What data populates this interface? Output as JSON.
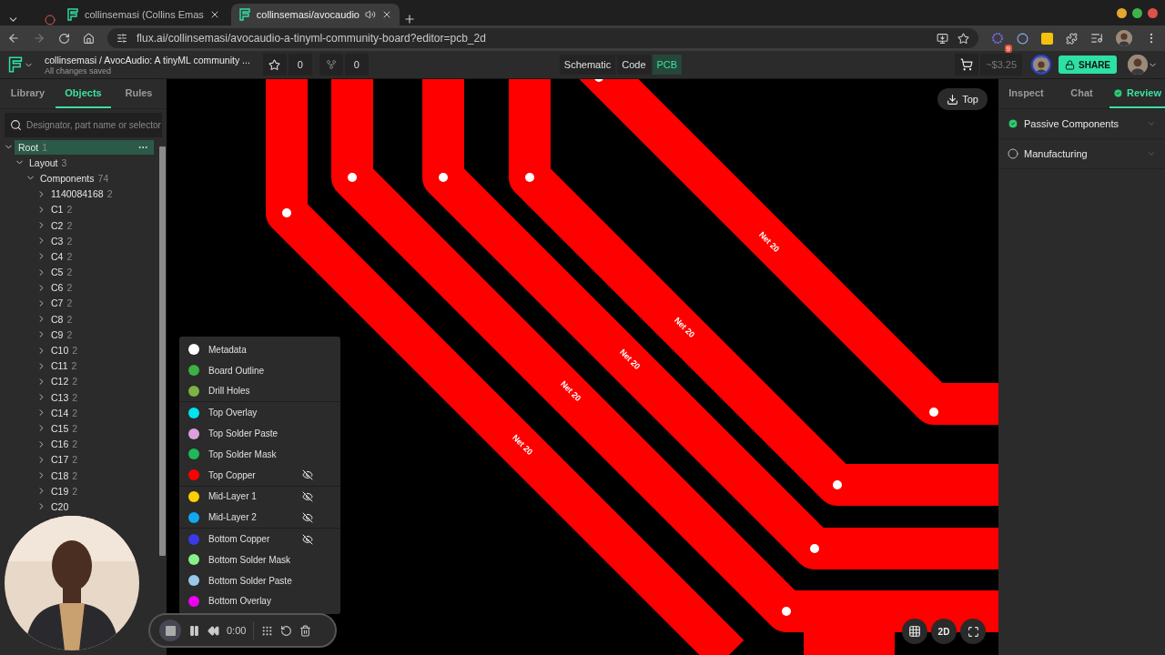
{
  "browser": {
    "tabs": [
      {
        "title": "collinsemasi (Collins Emas",
        "selected": false,
        "audio": false
      },
      {
        "title": "collinsemasi/avocaudio",
        "selected": true,
        "audio": true
      }
    ],
    "url": "flux.ai/collinsemasi/avocaudio-a-tinyml-community-board?editor=pcb_2d",
    "extension_badge": "9"
  },
  "header": {
    "project_title": "collinsemasi / AvocAudio: A tinyML community ...",
    "save_status": "All changes saved",
    "stars": "0",
    "forks": "0",
    "view_tabs": [
      {
        "label": "Schematic",
        "selected": false
      },
      {
        "label": "Code",
        "selected": false
      },
      {
        "label": "PCB",
        "selected": true
      }
    ],
    "price": "~$3.25",
    "share": "SHARE"
  },
  "left_panel": {
    "tabs": [
      {
        "label": "Library",
        "selected": false
      },
      {
        "label": "Objects",
        "selected": true
      },
      {
        "label": "Rules",
        "selected": false
      }
    ],
    "search": {
      "placeholder": "Designator, part name or selector"
    },
    "tree": [
      {
        "label": "Root",
        "count": "1",
        "expanded": true,
        "selected": true,
        "children": [
          {
            "label": "Layout",
            "count": "3",
            "expanded": true,
            "selected": false,
            "children": [
              {
                "label": "Components",
                "count": "74",
                "expanded": true,
                "selected": false,
                "children": [
                  {
                    "label": "1140084168",
                    "count": "2",
                    "expanded": false,
                    "selected": false
                  },
                  {
                    "label": "C1",
                    "count": "2",
                    "expanded": false,
                    "selected": false
                  },
                  {
                    "label": "C2",
                    "count": "2",
                    "expanded": false,
                    "selected": false
                  },
                  {
                    "label": "C3",
                    "count": "2",
                    "expanded": false,
                    "selected": false
                  },
                  {
                    "label": "C4",
                    "count": "2",
                    "expanded": false,
                    "selected": false
                  },
                  {
                    "label": "C5",
                    "count": "2",
                    "expanded": false,
                    "selected": false
                  },
                  {
                    "label": "C6",
                    "count": "2",
                    "expanded": false,
                    "selected": false
                  },
                  {
                    "label": "C7",
                    "count": "2",
                    "expanded": false,
                    "selected": false
                  },
                  {
                    "label": "C8",
                    "count": "2",
                    "expanded": false,
                    "selected": false
                  },
                  {
                    "label": "C9",
                    "count": "2",
                    "expanded": false,
                    "selected": false
                  },
                  {
                    "label": "C10",
                    "count": "2",
                    "expanded": false,
                    "selected": false
                  },
                  {
                    "label": "C11",
                    "count": "2",
                    "expanded": false,
                    "selected": false
                  },
                  {
                    "label": "C12",
                    "count": "2",
                    "expanded": false,
                    "selected": false
                  },
                  {
                    "label": "C13",
                    "count": "2",
                    "expanded": false,
                    "selected": false
                  },
                  {
                    "label": "C14",
                    "count": "2",
                    "expanded": false,
                    "selected": false
                  },
                  {
                    "label": "C15",
                    "count": "2",
                    "expanded": false,
                    "selected": false
                  },
                  {
                    "label": "C16",
                    "count": "2",
                    "expanded": false,
                    "selected": false
                  },
                  {
                    "label": "C17",
                    "count": "2",
                    "expanded": false,
                    "selected": false
                  },
                  {
                    "label": "C18",
                    "count": "2",
                    "expanded": false,
                    "selected": false
                  },
                  {
                    "label": "C19",
                    "count": "2",
                    "expanded": false,
                    "selected": false
                  },
                  {
                    "label": "C20",
                    "expanded": false,
                    "selected": false
                  }
                ]
              }
            ]
          }
        ]
      }
    ]
  },
  "canvas": {
    "side_button": "Top",
    "traces": [
      {
        "label": "Net 20"
      },
      {
        "label": "Net 20"
      },
      {
        "label": "Net 20"
      },
      {
        "label": "Net 20"
      },
      {
        "label": "Net 20"
      }
    ],
    "layer_groups": [
      {
        "layers": [
          {
            "name": "Metadata",
            "color": "#ffffff",
            "hidden": false
          },
          {
            "name": "Board Outline",
            "color": "#3cb043",
            "hidden": false
          },
          {
            "name": "Drill Holes",
            "color": "#7cb342",
            "hidden": false
          }
        ]
      },
      {
        "layers": [
          {
            "name": "Top Overlay",
            "color": "#00e5ee",
            "hidden": false
          },
          {
            "name": "Top Solder Paste",
            "color": "#dda0dd",
            "hidden": false
          },
          {
            "name": "Top Solder Mask",
            "color": "#20b85a",
            "hidden": false
          },
          {
            "name": "Top Copper",
            "color": "#ff0000",
            "hidden": true
          }
        ]
      },
      {
        "layers": [
          {
            "name": "Mid-Layer 1",
            "color": "#ffd000",
            "hidden": true
          },
          {
            "name": "Mid-Layer 2",
            "color": "#12a8f0",
            "hidden": true
          }
        ]
      },
      {
        "layers": [
          {
            "name": "Bottom Copper",
            "color": "#3a3ae8",
            "hidden": true
          },
          {
            "name": "Bottom Solder Mask",
            "color": "#88f088",
            "hidden": false
          },
          {
            "name": "Bottom Solder Paste",
            "color": "#99c8e8",
            "hidden": false
          },
          {
            "name": "Bottom Overlay",
            "color": "#f000f0",
            "hidden": false
          }
        ]
      }
    ],
    "view_mode": "2D"
  },
  "recorder": {
    "time": "0:00"
  },
  "right_panel": {
    "tabs": [
      {
        "label": "Inspect",
        "selected": false
      },
      {
        "label": "Chat",
        "selected": false
      },
      {
        "label": "Review",
        "selected": true
      }
    ],
    "checks": [
      {
        "label": "Passive Components",
        "passed": true
      },
      {
        "label": "Manufacturing",
        "passed": false
      }
    ]
  }
}
